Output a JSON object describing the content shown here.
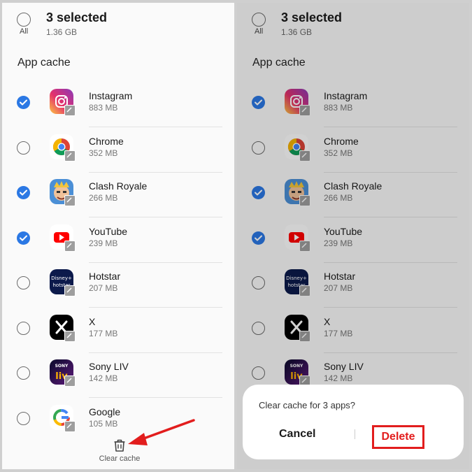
{
  "header": {
    "all_label": "All",
    "selected_title": "3 selected",
    "selected_size": "1.36 GB"
  },
  "section_title": "App cache",
  "apps": [
    {
      "name": "Instagram",
      "size": "883 MB",
      "checked": true,
      "icon": "instagram-icon"
    },
    {
      "name": "Chrome",
      "size": "352 MB",
      "checked": false,
      "icon": "chrome-icon"
    },
    {
      "name": "Clash Royale",
      "size": "266 MB",
      "checked": true,
      "icon": "clash-royale-icon"
    },
    {
      "name": "YouTube",
      "size": "239 MB",
      "checked": true,
      "icon": "youtube-icon"
    },
    {
      "name": "Hotstar",
      "size": "207 MB",
      "checked": false,
      "icon": "hotstar-icon"
    },
    {
      "name": "X",
      "size": "177 MB",
      "checked": false,
      "icon": "x-icon"
    },
    {
      "name": "Sony LIV",
      "size": "142 MB",
      "checked": false,
      "icon": "sony-liv-icon"
    },
    {
      "name": "Google",
      "size": "105 MB",
      "checked": false,
      "icon": "google-icon"
    }
  ],
  "footer": {
    "clear_cache_label": "Clear cache"
  },
  "dialog": {
    "message": "Clear cache for 3 apps?",
    "cancel_label": "Cancel",
    "delete_label": "Delete"
  },
  "colors": {
    "accent": "#2b78e4",
    "highlight": "#e21d1d"
  }
}
